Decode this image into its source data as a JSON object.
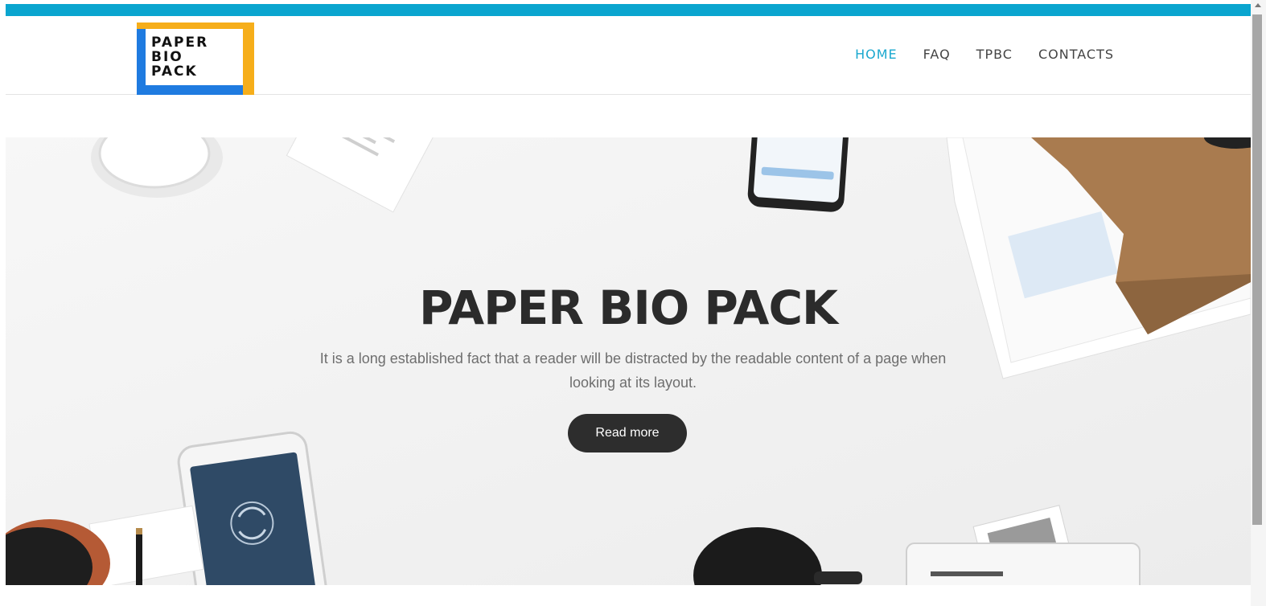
{
  "brand": {
    "logo_lines": [
      "PAPER",
      "BIO",
      "PACK"
    ]
  },
  "nav": {
    "items": [
      {
        "label": "HOME",
        "active": true
      },
      {
        "label": "FAQ",
        "active": false
      },
      {
        "label": "TPBC",
        "active": false
      },
      {
        "label": "CONTACTS",
        "active": false
      }
    ]
  },
  "hero": {
    "title": "PAPER BIO PACK",
    "subtitle": "It is a long established fact that a reader will be distracted by the readable content of a page when looking at its layout.",
    "button_label": "Read more"
  },
  "colors": {
    "accent": "#0aa5cf",
    "nav_active": "#1aa8cf",
    "button_bg": "#2d2d2d",
    "logo_yellow": "#f6ae1a",
    "logo_blue": "#1f7be0"
  }
}
